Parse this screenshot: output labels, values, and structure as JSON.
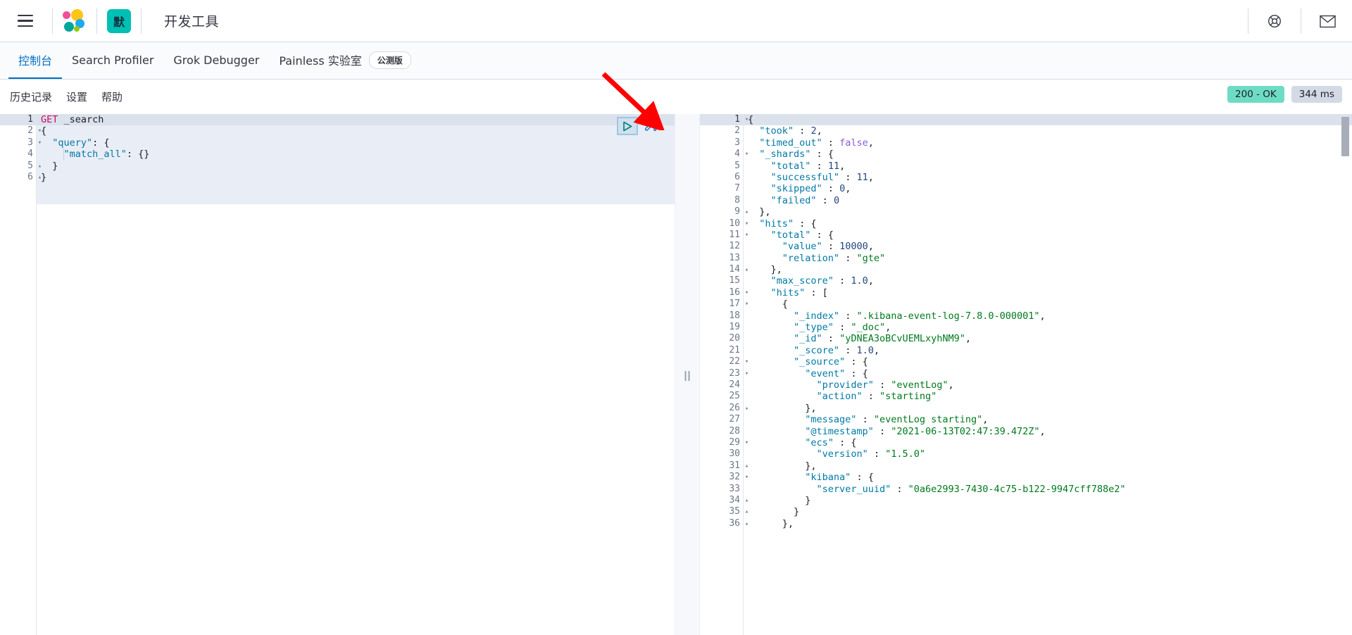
{
  "chrome": {
    "menu_icon": "hamburger-menu-icon",
    "logo_icon": "elastic-logo-icon",
    "space_badge": "默",
    "app_title": "开发工具",
    "help_icon": "help-lifebuoy-icon",
    "mail_icon": "mail-envelope-icon"
  },
  "app_tabs": [
    {
      "label": "控制台",
      "active": true
    },
    {
      "label": "Search Profiler",
      "active": false
    },
    {
      "label": "Grok Debugger",
      "active": false
    },
    {
      "label": "Painless 实验室",
      "active": false,
      "pill": "公测版"
    }
  ],
  "subnav": {
    "items": [
      {
        "label": "历史记录"
      },
      {
        "label": "设置"
      },
      {
        "label": "帮助"
      }
    ],
    "status_code": "200 - OK",
    "status_color": "#6edcc4",
    "elapsed": "344 ms",
    "elapsed_color": "#d3dae6"
  },
  "editor": {
    "play_icon": "play-triangle-icon",
    "wrench_icon": "wrench-icon",
    "annotation_icon": "red-arrow-annotation",
    "lines": [
      {
        "n": "1",
        "fold": "",
        "active": true,
        "tokens": [
          {
            "t": "GET",
            "c": "k-method"
          },
          {
            "t": " _search",
            "c": "k-url"
          }
        ]
      },
      {
        "n": "2",
        "fold": "▾",
        "active": false,
        "tokens": [
          {
            "t": "{",
            "c": "k-punc"
          }
        ]
      },
      {
        "n": "3",
        "fold": "▾",
        "active": false,
        "tokens": [
          {
            "t": "  ",
            "c": "k-punc"
          },
          {
            "t": "\"query\"",
            "c": "k-key"
          },
          {
            "t": ": {",
            "c": "k-punc"
          }
        ]
      },
      {
        "n": "4",
        "fold": "",
        "active": false,
        "tokens": [
          {
            "t": "    ",
            "c": "k-punc"
          },
          {
            "t": "\"match_all\"",
            "c": "k-key"
          },
          {
            "t": ": {}",
            "c": "k-punc"
          }
        ]
      },
      {
        "n": "5",
        "fold": "▴",
        "active": false,
        "tokens": [
          {
            "t": "  }",
            "c": "k-punc"
          }
        ]
      },
      {
        "n": "6",
        "fold": "▴",
        "active": false,
        "tokens": [
          {
            "t": "}",
            "c": "k-punc"
          }
        ]
      }
    ]
  },
  "response": {
    "scrollbar": "vertical-scrollbar",
    "lines": [
      {
        "n": "1",
        "fold": "▾",
        "active": true,
        "tokens": [
          {
            "t": "{",
            "c": "k-punc"
          }
        ]
      },
      {
        "n": "2",
        "fold": "",
        "active": false,
        "tokens": [
          {
            "t": "  ",
            "c": "k-punc"
          },
          {
            "t": "\"took\"",
            "c": "k-key"
          },
          {
            "t": " : ",
            "c": "k-punc"
          },
          {
            "t": "2",
            "c": "k-num"
          },
          {
            "t": ",",
            "c": "k-punc"
          }
        ]
      },
      {
        "n": "3",
        "fold": "",
        "active": false,
        "tokens": [
          {
            "t": "  ",
            "c": "k-punc"
          },
          {
            "t": "\"timed_out\"",
            "c": "k-key"
          },
          {
            "t": " : ",
            "c": "k-punc"
          },
          {
            "t": "false",
            "c": "k-bool"
          },
          {
            "t": ",",
            "c": "k-punc"
          }
        ]
      },
      {
        "n": "4",
        "fold": "▾",
        "active": false,
        "tokens": [
          {
            "t": "  ",
            "c": "k-punc"
          },
          {
            "t": "\"_shards\"",
            "c": "k-key"
          },
          {
            "t": " : {",
            "c": "k-punc"
          }
        ]
      },
      {
        "n": "5",
        "fold": "",
        "active": false,
        "tokens": [
          {
            "t": "    ",
            "c": "k-punc"
          },
          {
            "t": "\"total\"",
            "c": "k-key"
          },
          {
            "t": " : ",
            "c": "k-punc"
          },
          {
            "t": "11",
            "c": "k-num"
          },
          {
            "t": ",",
            "c": "k-punc"
          }
        ]
      },
      {
        "n": "6",
        "fold": "",
        "active": false,
        "tokens": [
          {
            "t": "    ",
            "c": "k-punc"
          },
          {
            "t": "\"successful\"",
            "c": "k-key"
          },
          {
            "t": " : ",
            "c": "k-punc"
          },
          {
            "t": "11",
            "c": "k-num"
          },
          {
            "t": ",",
            "c": "k-punc"
          }
        ]
      },
      {
        "n": "7",
        "fold": "",
        "active": false,
        "tokens": [
          {
            "t": "    ",
            "c": "k-punc"
          },
          {
            "t": "\"skipped\"",
            "c": "k-key"
          },
          {
            "t": " : ",
            "c": "k-punc"
          },
          {
            "t": "0",
            "c": "k-num"
          },
          {
            "t": ",",
            "c": "k-punc"
          }
        ]
      },
      {
        "n": "8",
        "fold": "",
        "active": false,
        "tokens": [
          {
            "t": "    ",
            "c": "k-punc"
          },
          {
            "t": "\"failed\"",
            "c": "k-key"
          },
          {
            "t": " : ",
            "c": "k-punc"
          },
          {
            "t": "0",
            "c": "k-num"
          }
        ]
      },
      {
        "n": "9",
        "fold": "▴",
        "active": false,
        "tokens": [
          {
            "t": "  },",
            "c": "k-punc"
          }
        ]
      },
      {
        "n": "10",
        "fold": "▾",
        "active": false,
        "tokens": [
          {
            "t": "  ",
            "c": "k-punc"
          },
          {
            "t": "\"hits\"",
            "c": "k-key"
          },
          {
            "t": " : {",
            "c": "k-punc"
          }
        ]
      },
      {
        "n": "11",
        "fold": "▾",
        "active": false,
        "tokens": [
          {
            "t": "    ",
            "c": "k-punc"
          },
          {
            "t": "\"total\"",
            "c": "k-key"
          },
          {
            "t": " : {",
            "c": "k-punc"
          }
        ]
      },
      {
        "n": "12",
        "fold": "",
        "active": false,
        "tokens": [
          {
            "t": "      ",
            "c": "k-punc"
          },
          {
            "t": "\"value\"",
            "c": "k-key"
          },
          {
            "t": " : ",
            "c": "k-punc"
          },
          {
            "t": "10000",
            "c": "k-num"
          },
          {
            "t": ",",
            "c": "k-punc"
          }
        ]
      },
      {
        "n": "13",
        "fold": "",
        "active": false,
        "tokens": [
          {
            "t": "      ",
            "c": "k-punc"
          },
          {
            "t": "\"relation\"",
            "c": "k-key"
          },
          {
            "t": " : ",
            "c": "k-punc"
          },
          {
            "t": "\"gte\"",
            "c": "k-str"
          }
        ]
      },
      {
        "n": "14",
        "fold": "▴",
        "active": false,
        "tokens": [
          {
            "t": "    },",
            "c": "k-punc"
          }
        ]
      },
      {
        "n": "15",
        "fold": "",
        "active": false,
        "tokens": [
          {
            "t": "    ",
            "c": "k-punc"
          },
          {
            "t": "\"max_score\"",
            "c": "k-key"
          },
          {
            "t": " : ",
            "c": "k-punc"
          },
          {
            "t": "1.0",
            "c": "k-num"
          },
          {
            "t": ",",
            "c": "k-punc"
          }
        ]
      },
      {
        "n": "16",
        "fold": "▾",
        "active": false,
        "tokens": [
          {
            "t": "    ",
            "c": "k-punc"
          },
          {
            "t": "\"hits\"",
            "c": "k-key"
          },
          {
            "t": " : [",
            "c": "k-punc"
          }
        ]
      },
      {
        "n": "17",
        "fold": "▾",
        "active": false,
        "tokens": [
          {
            "t": "      {",
            "c": "k-punc"
          }
        ]
      },
      {
        "n": "18",
        "fold": "",
        "active": false,
        "tokens": [
          {
            "t": "        ",
            "c": "k-punc"
          },
          {
            "t": "\"_index\"",
            "c": "k-key"
          },
          {
            "t": " : ",
            "c": "k-punc"
          },
          {
            "t": "\".kibana-event-log-7.8.0-000001\"",
            "c": "k-str"
          },
          {
            "t": ",",
            "c": "k-punc"
          }
        ]
      },
      {
        "n": "19",
        "fold": "",
        "active": false,
        "tokens": [
          {
            "t": "        ",
            "c": "k-punc"
          },
          {
            "t": "\"_type\"",
            "c": "k-key"
          },
          {
            "t": " : ",
            "c": "k-punc"
          },
          {
            "t": "\"_doc\"",
            "c": "k-str"
          },
          {
            "t": ",",
            "c": "k-punc"
          }
        ]
      },
      {
        "n": "20",
        "fold": "",
        "active": false,
        "tokens": [
          {
            "t": "        ",
            "c": "k-punc"
          },
          {
            "t": "\"_id\"",
            "c": "k-key"
          },
          {
            "t": " : ",
            "c": "k-punc"
          },
          {
            "t": "\"yDNEA3oBCvUEMLxyhNM9\"",
            "c": "k-str"
          },
          {
            "t": ",",
            "c": "k-punc"
          }
        ]
      },
      {
        "n": "21",
        "fold": "",
        "active": false,
        "tokens": [
          {
            "t": "        ",
            "c": "k-punc"
          },
          {
            "t": "\"_score\"",
            "c": "k-key"
          },
          {
            "t": " : ",
            "c": "k-punc"
          },
          {
            "t": "1.0",
            "c": "k-num"
          },
          {
            "t": ",",
            "c": "k-punc"
          }
        ]
      },
      {
        "n": "22",
        "fold": "▾",
        "active": false,
        "tokens": [
          {
            "t": "        ",
            "c": "k-punc"
          },
          {
            "t": "\"_source\"",
            "c": "k-key"
          },
          {
            "t": " : {",
            "c": "k-punc"
          }
        ]
      },
      {
        "n": "23",
        "fold": "▾",
        "active": false,
        "tokens": [
          {
            "t": "          ",
            "c": "k-punc"
          },
          {
            "t": "\"event\"",
            "c": "k-key"
          },
          {
            "t": " : {",
            "c": "k-punc"
          }
        ]
      },
      {
        "n": "24",
        "fold": "",
        "active": false,
        "tokens": [
          {
            "t": "            ",
            "c": "k-punc"
          },
          {
            "t": "\"provider\"",
            "c": "k-key"
          },
          {
            "t": " : ",
            "c": "k-punc"
          },
          {
            "t": "\"eventLog\"",
            "c": "k-str"
          },
          {
            "t": ",",
            "c": "k-punc"
          }
        ]
      },
      {
        "n": "25",
        "fold": "",
        "active": false,
        "tokens": [
          {
            "t": "            ",
            "c": "k-punc"
          },
          {
            "t": "\"action\"",
            "c": "k-key"
          },
          {
            "t": " : ",
            "c": "k-punc"
          },
          {
            "t": "\"starting\"",
            "c": "k-str"
          }
        ]
      },
      {
        "n": "26",
        "fold": "▴",
        "active": false,
        "tokens": [
          {
            "t": "          },",
            "c": "k-punc"
          }
        ]
      },
      {
        "n": "27",
        "fold": "",
        "active": false,
        "tokens": [
          {
            "t": "          ",
            "c": "k-punc"
          },
          {
            "t": "\"message\"",
            "c": "k-key"
          },
          {
            "t": " : ",
            "c": "k-punc"
          },
          {
            "t": "\"eventLog starting\"",
            "c": "k-str"
          },
          {
            "t": ",",
            "c": "k-punc"
          }
        ]
      },
      {
        "n": "28",
        "fold": "",
        "active": false,
        "tokens": [
          {
            "t": "          ",
            "c": "k-punc"
          },
          {
            "t": "\"@timestamp\"",
            "c": "k-key"
          },
          {
            "t": " : ",
            "c": "k-punc"
          },
          {
            "t": "\"2021-06-13T02:47:39.472Z\"",
            "c": "k-str"
          },
          {
            "t": ",",
            "c": "k-punc"
          }
        ]
      },
      {
        "n": "29",
        "fold": "▾",
        "active": false,
        "tokens": [
          {
            "t": "          ",
            "c": "k-punc"
          },
          {
            "t": "\"ecs\"",
            "c": "k-key"
          },
          {
            "t": " : {",
            "c": "k-punc"
          }
        ]
      },
      {
        "n": "30",
        "fold": "",
        "active": false,
        "tokens": [
          {
            "t": "            ",
            "c": "k-punc"
          },
          {
            "t": "\"version\"",
            "c": "k-key"
          },
          {
            "t": " : ",
            "c": "k-punc"
          },
          {
            "t": "\"1.5.0\"",
            "c": "k-str"
          }
        ]
      },
      {
        "n": "31",
        "fold": "▴",
        "active": false,
        "tokens": [
          {
            "t": "          },",
            "c": "k-punc"
          }
        ]
      },
      {
        "n": "32",
        "fold": "▾",
        "active": false,
        "tokens": [
          {
            "t": "          ",
            "c": "k-punc"
          },
          {
            "t": "\"kibana\"",
            "c": "k-key"
          },
          {
            "t": " : {",
            "c": "k-punc"
          }
        ]
      },
      {
        "n": "33",
        "fold": "",
        "active": false,
        "tokens": [
          {
            "t": "            ",
            "c": "k-punc"
          },
          {
            "t": "\"server_uuid\"",
            "c": "k-key"
          },
          {
            "t": " : ",
            "c": "k-punc"
          },
          {
            "t": "\"0a6e2993-7430-4c75-b122-9947cff788e2\"",
            "c": "k-str"
          }
        ]
      },
      {
        "n": "34",
        "fold": "▴",
        "active": false,
        "tokens": [
          {
            "t": "          }",
            "c": "k-punc"
          }
        ]
      },
      {
        "n": "35",
        "fold": "▴",
        "active": false,
        "tokens": [
          {
            "t": "        }",
            "c": "k-punc"
          }
        ]
      },
      {
        "n": "36",
        "fold": "▴",
        "active": false,
        "tokens": [
          {
            "t": "      },",
            "c": "k-punc"
          }
        ]
      }
    ]
  }
}
